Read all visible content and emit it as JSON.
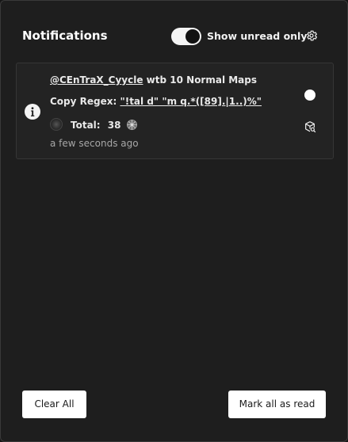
{
  "panel": {
    "title": "Notifications",
    "toggle": {
      "label": "Show unread only",
      "on": true
    },
    "settings_icon": "gear-icon"
  },
  "notification": {
    "type_icon": "info-icon",
    "user": "@CEnTraX_Cyycle",
    "message": " wtb 10 Normal Maps",
    "regex_label": "Copy Regex: ",
    "regex_value": "\"!tal d\" \"m q.*([89].|1..)%\"",
    "total_label": "Total:",
    "total_value": "38",
    "currency_icon": "orb-icon",
    "timestamp": "a few seconds ago",
    "unread_icon": "unread-dot-icon",
    "action_icon": "trade-icon"
  },
  "footer": {
    "clear_label": "Clear All",
    "mark_read_label": "Mark all as read"
  }
}
